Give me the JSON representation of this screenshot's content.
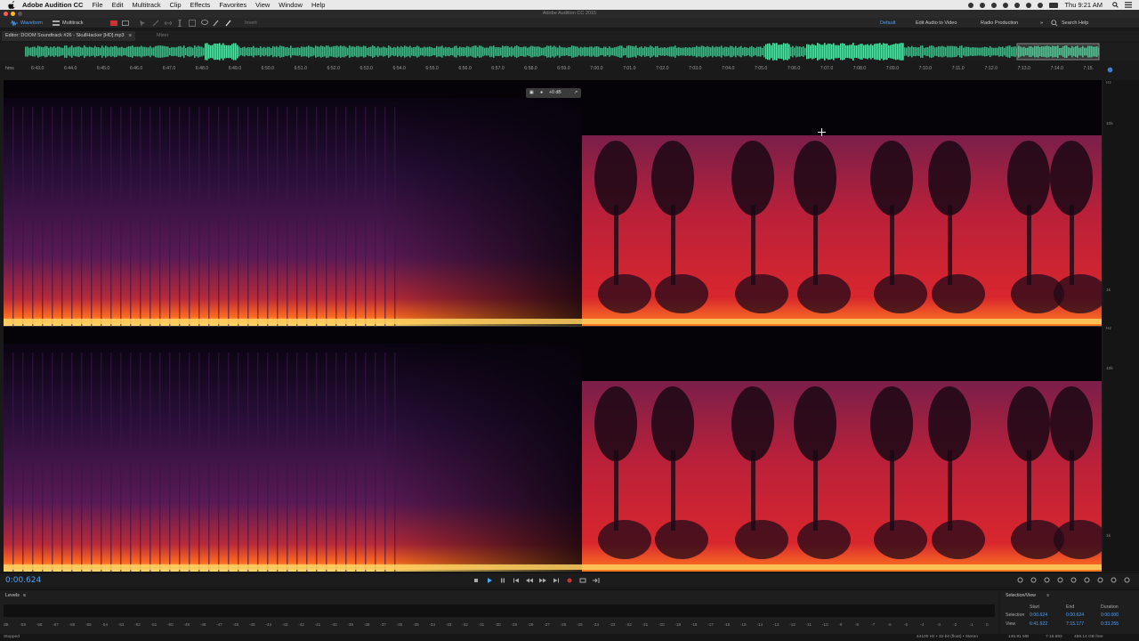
{
  "menubar": {
    "app_name": "Adobe Audition CC",
    "items": [
      "File",
      "Edit",
      "Multitrack",
      "Clip",
      "Effects",
      "Favorites",
      "View",
      "Window",
      "Help"
    ],
    "clock": "Thu 9:21 AM"
  },
  "window": {
    "title": "Adobe Audition CC 2015"
  },
  "toolbar": {
    "waveform_label": "Waveform",
    "multitrack_label": "Multitrack",
    "invert_label": "Invert",
    "workspaces": [
      "Default",
      "Edit Audio to Video",
      "Radio Production"
    ],
    "search_help": "Search Help"
  },
  "editor": {
    "tab_label": "Editor: DOOM  Soundtrack #26 - SkullHacker [HD].mp3",
    "mixer_label": "Mixer"
  },
  "ruler": {
    "unit": "hms",
    "ticks": [
      "6:43.0",
      "6:44.0",
      "6:45.0",
      "6:46.0",
      "6:47.0",
      "6:48.0",
      "6:49.0",
      "6:50.0",
      "6:51.0",
      "6:52.0",
      "6:53.0",
      "6:54.0",
      "6:55.0",
      "6:56.0",
      "6:57.0",
      "6:58.0",
      "6:59.0",
      "7:00.0",
      "7:01.0",
      "7:02.0",
      "7:03.0",
      "7:04.0",
      "7:05.0",
      "7:06.0",
      "7:07.0",
      "7:08.0",
      "7:09.0",
      "7:10.0",
      "7:11.0",
      "7:12.0",
      "7:13.0",
      "7:14.0",
      "7:15."
    ]
  },
  "hud": {
    "value": "+0 dB"
  },
  "hz_axis": {
    "unit": "Hz",
    "labels": [
      "10k",
      "1k"
    ]
  },
  "transport": {
    "timecode": "0:00.624"
  },
  "levels": {
    "title": "Levels",
    "scale": [
      "dB",
      "-59",
      "-58",
      "-57",
      "-56",
      "-55",
      "-54",
      "-53",
      "-52",
      "-51",
      "-50",
      "-49",
      "-48",
      "-47",
      "-46",
      "-45",
      "-44",
      "-43",
      "-42",
      "-41",
      "-40",
      "-39",
      "-38",
      "-37",
      "-36",
      "-35",
      "-34",
      "-33",
      "-32",
      "-31",
      "-30",
      "-29",
      "-28",
      "-27",
      "-26",
      "-25",
      "-24",
      "-23",
      "-22",
      "-21",
      "-20",
      "-19",
      "-18",
      "-17",
      "-16",
      "-15",
      "-14",
      "-13",
      "-12",
      "-11",
      "-10",
      "-9",
      "-8",
      "-7",
      "-6",
      "-5",
      "-4",
      "-3",
      "-2",
      "-1",
      "0"
    ]
  },
  "selection_view": {
    "title": "Selection/View",
    "col_start": "Start",
    "col_end": "End",
    "col_duration": "Duration",
    "selection_label": "Selection",
    "selection_start": "0:00.624",
    "selection_end": "0:00.624",
    "selection_duration": "0:00.000",
    "view_label": "View",
    "view_start": "6:41.922",
    "view_end": "7:15.177",
    "view_duration": "0:33.255"
  },
  "status": {
    "state": "Stopped",
    "format": "44100 Hz • 32-bit (float) • Stereo",
    "size": "146.91 MB",
    "duration": "7:15.983",
    "free": "488.14 GB free"
  },
  "colors": {
    "accent": "#4aa3ff",
    "waveform": "#56e0a5"
  }
}
